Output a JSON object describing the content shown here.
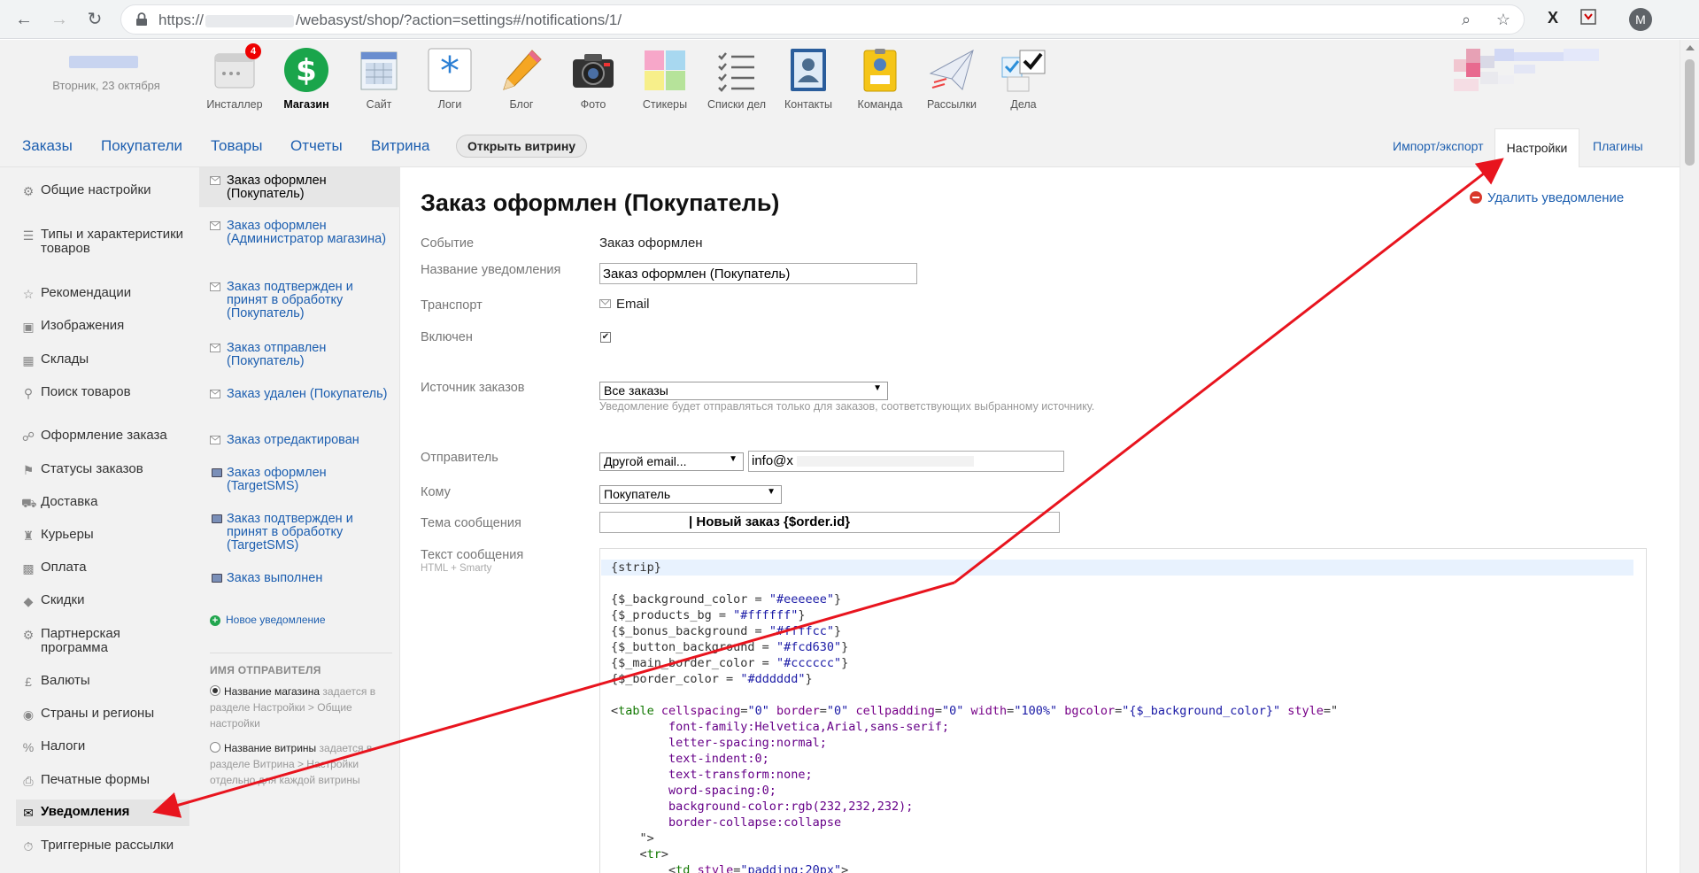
{
  "browser": {
    "url_prefix": "https://",
    "url_path": "/webasyst/shop/?action=settings#/notifications/1/",
    "profile_initial": "M"
  },
  "header": {
    "date": "Вторник, 23 октября",
    "apps": [
      {
        "label": "Инсталлер",
        "icon": "installer-icon",
        "badge": "4"
      },
      {
        "label": "Магазин",
        "icon": "shop-icon"
      },
      {
        "label": "Сайт",
        "icon": "site-icon"
      },
      {
        "label": "Логи",
        "icon": "logs-icon"
      },
      {
        "label": "Блог",
        "icon": "blog-icon"
      },
      {
        "label": "Фото",
        "icon": "photo-icon"
      },
      {
        "label": "Стикеры",
        "icon": "stickers-icon"
      },
      {
        "label": "Списки дел",
        "icon": "checklists-icon"
      },
      {
        "label": "Контакты",
        "icon": "contacts-icon"
      },
      {
        "label": "Команда",
        "icon": "team-icon"
      },
      {
        "label": "Рассылки",
        "icon": "mailer-icon"
      },
      {
        "label": "Дела",
        "icon": "tasks-icon"
      }
    ]
  },
  "shopmenu": {
    "items": [
      "Заказы",
      "Покупатели",
      "Товары",
      "Отчеты",
      "Витрина"
    ],
    "open_store": "Открыть витрину",
    "import_export": "Импорт/экспорт",
    "settings": "Настройки",
    "plugins": "Плагины"
  },
  "sidebar": {
    "items": [
      {
        "label": "Общие настройки",
        "icon": "gears-icon"
      },
      {
        "label": "Типы и характеристики товаров",
        "icon": "list-icon"
      },
      {
        "label": "Рекомендации",
        "icon": "star-icon"
      },
      {
        "label": "Изображения",
        "icon": "camera-icon"
      },
      {
        "label": "Склады",
        "icon": "box-icon"
      },
      {
        "label": "Поиск товаров",
        "icon": "search-icon"
      },
      {
        "label": "Оформление заказа",
        "icon": "cart-icon"
      },
      {
        "label": "Статусы заказов",
        "icon": "flag-icon"
      },
      {
        "label": "Доставка",
        "icon": "truck-icon"
      },
      {
        "label": "Курьеры",
        "icon": "courier-icon"
      },
      {
        "label": "Оплата",
        "icon": "card-icon"
      },
      {
        "label": "Скидки",
        "icon": "tag-icon"
      },
      {
        "label": "Партнерская программа",
        "icon": "affiliate-icon"
      },
      {
        "label": "Валюты",
        "icon": "currency-icon"
      },
      {
        "label": "Страны и регионы",
        "icon": "globe-icon"
      },
      {
        "label": "Налоги",
        "icon": "percent-icon"
      },
      {
        "label": "Печатные формы",
        "icon": "printer-icon"
      },
      {
        "label": "Уведомления",
        "icon": "envelope-icon"
      },
      {
        "label": "Триггерные рассылки",
        "icon": "timer-icon"
      }
    ]
  },
  "notifications": {
    "items": [
      {
        "label": "Заказ оформлен (Покупатель)",
        "transport": "email"
      },
      {
        "label": "Заказ оформлен (Администратор магазина)",
        "transport": "email"
      },
      {
        "label": "Заказ подтвержден и принят в обработку (Покупатель)",
        "transport": "email"
      },
      {
        "label": "Заказ отправлен (Покупатель)",
        "transport": "email"
      },
      {
        "label": "Заказ удален (Покупатель)",
        "transport": "email"
      },
      {
        "label": "Заказ отредактирован",
        "transport": "email"
      },
      {
        "label": "Заказ оформлен (TargetSMS)",
        "transport": "sms"
      },
      {
        "label": "Заказ подтвержден и принят в обработку (TargetSMS)",
        "transport": "sms"
      },
      {
        "label": "Заказ выполнен",
        "transport": "sms"
      }
    ],
    "new_label": "Новое уведомление",
    "sender_title": "ИМЯ ОТПРАВИТЕЛЯ",
    "sender_opt1_name": "Название магазина",
    "sender_opt1_desc": "задается в разделе Настройки > Общие настройки",
    "sender_opt2_name": "Название витрины",
    "sender_opt2_desc": "задается в разделе Витрина > Настройки отдельно для каждой витрины"
  },
  "form": {
    "title": "Заказ оформлен (Покупатель)",
    "delete": "Удалить уведомление",
    "event_label": "Событие",
    "event_value": "Заказ оформлен",
    "name_label": "Название уведомления",
    "name_value": "Заказ оформлен (Покупатель)",
    "transport_label": "Транспорт",
    "transport_value": "Email",
    "enabled_label": "Включен",
    "enabled": true,
    "source_label": "Источник заказов",
    "source_value": "Все заказы",
    "source_hint": "Уведомление будет отправляться только для заказов, соответствующих выбранному источнику.",
    "sender_label": "Отправитель",
    "sender_type": "Другой email...",
    "sender_email": "info@x",
    "to_label": "Кому",
    "to_value": "Покупатель",
    "subject_label": "Тема сообщения",
    "subject_value": "| Новый заказ {$order.id}",
    "body_label": "Текст сообщения",
    "body_sub": "HTML + Smarty"
  },
  "code": {
    "lines": [
      "{strip}",
      "",
      "{$_background_color = \"#eeeeee\"}",
      "{$_products_bg = \"#ffffff\"}",
      "{$_bonus_background = \"#ffffcc\"}",
      "{$_button_background = \"#fcd630\"}",
      "{$_main_border_color = \"#cccccc\"}",
      "{$_border_color = \"#dddddd\"}",
      "",
      "<table cellspacing=\"0\" border=\"0\" cellpadding=\"0\" width=\"100%\" bgcolor=\"{$_background_color}\" style=\"",
      "        font-family:Helvetica,Arial,sans-serif;",
      "        letter-spacing:normal;",
      "        text-indent:0;",
      "        text-transform:none;",
      "        word-spacing:0;",
      "        background-color:rgb(232,232,232);",
      "        border-collapse:collapse",
      "    \">",
      "    <tr>",
      "        <td style=\"padding:20px\">"
    ]
  },
  "colors": {
    "link": "#1d5fb0",
    "annotation_arrow": "#e8141e"
  }
}
